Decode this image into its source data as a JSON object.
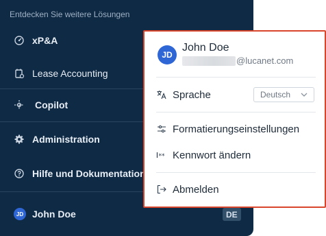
{
  "sidebar": {
    "section_title": "Entdecken Sie weitere Lösungen",
    "items": [
      {
        "label": "xP&A",
        "icon": "xpa-gauge-icon"
      },
      {
        "label": "Lease Accounting",
        "icon": "lease-document-icon"
      },
      {
        "label": "Copilot",
        "icon": "copilot-sparkle-icon"
      },
      {
        "label": "Administration",
        "icon": "gear-icon"
      },
      {
        "label": "Hilfe und Dokumentation",
        "icon": "help-circle-icon"
      }
    ],
    "user": {
      "initials": "JD",
      "name": "John Doe",
      "language_badge": "DE"
    }
  },
  "popup": {
    "avatar_initials": "JD",
    "name": "John Doe",
    "email_visible": "@lucanet.com",
    "language": {
      "label": "Sprache",
      "selected": "Deutsch",
      "icon": "translate-icon"
    },
    "items": [
      {
        "label": "Formatierungseinstellungen",
        "icon": "sliders-icon"
      },
      {
        "label": "Kennwort ändern",
        "icon": "password-icon"
      },
      {
        "label": "Abmelden",
        "icon": "logout-icon"
      }
    ],
    "border_color": "#d9452b"
  },
  "colors": {
    "sidebar_bg": "#0f2a45",
    "avatar": "#2f66d6"
  }
}
